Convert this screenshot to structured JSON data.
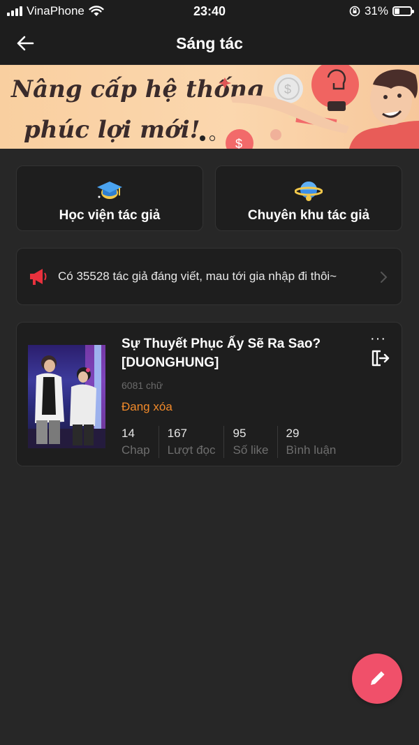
{
  "status_bar": {
    "carrier": "VinaPhone",
    "time": "23:40",
    "battery": "31%"
  },
  "nav": {
    "title": "Sáng tác"
  },
  "banner": {
    "line1": "Nâng cấp hệ thống",
    "line2": "phúc lợi mới!",
    "slides": 2,
    "active_slide": 1
  },
  "features": [
    {
      "label": "Học viện tác giả",
      "icon": "graduation-cap-icon"
    },
    {
      "label": "Chuyên khu tác giả",
      "icon": "planet-icon"
    }
  ],
  "notice": {
    "text": "Có 35528 tác giả đáng viết, mau tới gia nhập đi thôi~",
    "icon": "megaphone-icon"
  },
  "story": {
    "title": "Sự Thuyết Phục Ấy Sẽ Ra Sao? [DUONGHUNG]",
    "words": "6081 chữ",
    "status": "Đang xóa",
    "stats": [
      {
        "value": "14",
        "label": "Chap"
      },
      {
        "value": "167",
        "label": "Lượt đọc"
      },
      {
        "value": "95",
        "label": "Số like"
      },
      {
        "value": "29",
        "label": "Bình luận"
      }
    ],
    "more": "···"
  },
  "colors": {
    "background": "#272727",
    "card": "#1e1e1e",
    "accent_fab": "#f0506a",
    "status_orange": "#f28a2a",
    "notice_red": "#e8313d"
  }
}
